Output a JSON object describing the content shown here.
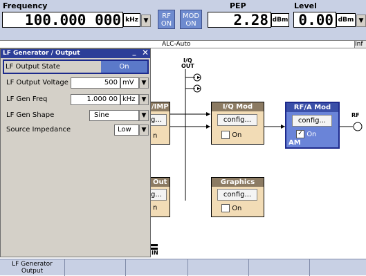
{
  "header": {
    "frequency_label": "Frequency",
    "frequency_value": "100.000 000",
    "frequency_unit": "kHz",
    "rf_toggle": {
      "line1": "RF",
      "line2": "ON"
    },
    "mod_toggle": {
      "line1": "MOD",
      "line2": "ON"
    },
    "pep_label": "PEP",
    "pep_value": "2.28",
    "pep_unit": "dBm",
    "level_label": "Level",
    "level_value": "0.00",
    "level_unit": "dBm",
    "alc_status": "ALC-Auto",
    "info_label": "Inf"
  },
  "dialog": {
    "title": "LF Generator / Output",
    "rows": [
      {
        "label": "LF Output State",
        "value": "On"
      },
      {
        "label": "LF Output Voltage",
        "value": "500",
        "unit": "mV"
      },
      {
        "label": "LF Gen Freq",
        "value": "1.000 00",
        "unit": "kHz"
      },
      {
        "label": "LF Gen Shape",
        "value": "Sine"
      },
      {
        "label": "Source Impedance",
        "value": "Low"
      }
    ]
  },
  "diagram": {
    "iq_out_label": "I/Q\nOUT",
    "rf_label": "RF",
    "blocks": {
      "fmpm": {
        "title": "/IMP",
        "btn": "g...",
        "state": "n"
      },
      "iqmod": {
        "title": "I/Q Mod",
        "btn": "config...",
        "state": "On",
        "checked": false
      },
      "rfmod": {
        "title": "RF/A Mod",
        "btn": "config...",
        "state": "On",
        "checked": true,
        "sub": "AM"
      },
      "lfout": {
        "title": "Out",
        "btn": "g...",
        "state": "n"
      },
      "graphics": {
        "title": "Graphics",
        "btn": "config...",
        "state": "On",
        "checked": false
      }
    },
    "bottom_port": "IN"
  },
  "softkeys": [
    "LF Generator\nOutput",
    "",
    "",
    "",
    "",
    ""
  ],
  "colors": {
    "header_bg": "#c8d0e4",
    "title_bar": "#2c3e98",
    "active_row": "#5b79c9",
    "block_bg": "#f2dcb6",
    "rf_block": "#6a84d8"
  }
}
